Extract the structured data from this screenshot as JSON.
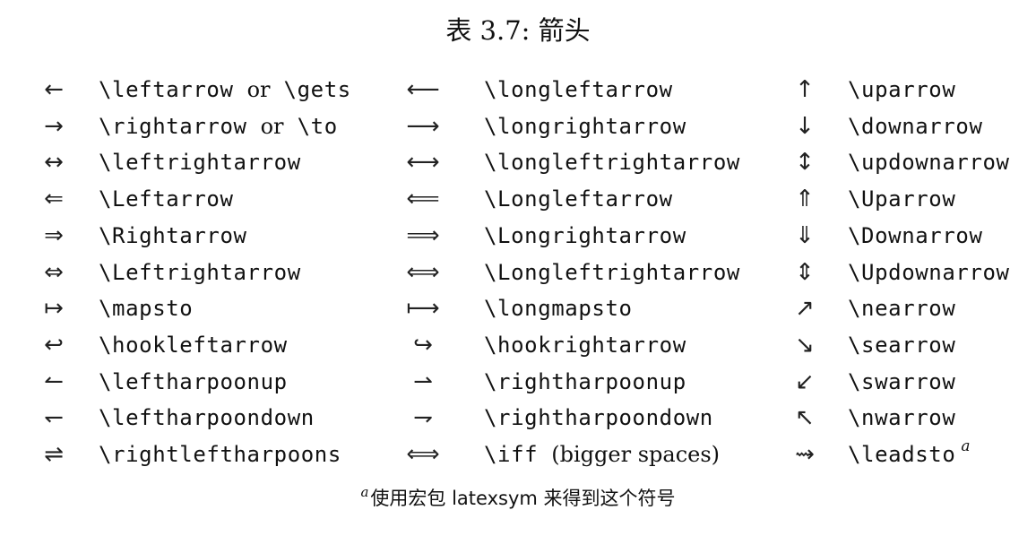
{
  "caption": "表 3.7: 箭头",
  "rows": [
    {
      "s1": "←",
      "c1": "\\leftarrow",
      "c1_or": "or",
      "c1_alt": "\\gets",
      "s2": "⟵",
      "c2": "\\longleftarrow",
      "s3": "↑",
      "c3": "\\uparrow"
    },
    {
      "s1": "→",
      "c1": "\\rightarrow",
      "c1_or": "or",
      "c1_alt": "\\to",
      "s2": "⟶",
      "c2": "\\longrightarrow",
      "s3": "↓",
      "c3": "\\downarrow"
    },
    {
      "s1": "↔",
      "c1": "\\leftrightarrow",
      "s2": "⟷",
      "c2": "\\longleftrightarrow",
      "s3": "↕",
      "c3": "\\updownarrow"
    },
    {
      "s1": "⇐",
      "c1": "\\Leftarrow",
      "s2": "⟸",
      "c2": "\\Longleftarrow",
      "s3": "⇑",
      "c3": "\\Uparrow"
    },
    {
      "s1": "⇒",
      "c1": "\\Rightarrow",
      "s2": "⟹",
      "c2": "\\Longrightarrow",
      "s3": "⇓",
      "c3": "\\Downarrow"
    },
    {
      "s1": "⇔",
      "c1": "\\Leftrightarrow",
      "s2": "⟺",
      "c2": "\\Longleftrightarrow",
      "s3": "⇕",
      "c3": "\\Updownarrow"
    },
    {
      "s1": "↦",
      "c1": "\\mapsto",
      "s2": "⟼",
      "c2": "\\longmapsto",
      "s3": "↗",
      "c3": "\\nearrow"
    },
    {
      "s1": "↩",
      "c1": "\\hookleftarrow",
      "s2": "↪",
      "c2": "\\hookrightarrow",
      "s3": "↘",
      "c3": "\\searrow"
    },
    {
      "s1": "↼",
      "c1": "\\leftharpoonup",
      "s2": "⇀",
      "c2": "\\rightharpoonup",
      "s3": "↙",
      "c3": "\\swarrow"
    },
    {
      "s1": "↽",
      "c1": "\\leftharpoondown",
      "s2": "⇁",
      "c2": "\\rightharpoondown",
      "s3": "↖",
      "c3": "\\nwarrow"
    },
    {
      "s1": "⇌",
      "c1": "\\rightleftharpoons",
      "s2": "⟺",
      "c2": "\\iff",
      "c2_extra": "(bigger spaces)",
      "s3": "⇝",
      "c3": "\\leadsto",
      "c3_sup": "a"
    }
  ],
  "footnote": {
    "mark": "a",
    "text": "使用宏包 latexsym 来得到这个符号"
  }
}
